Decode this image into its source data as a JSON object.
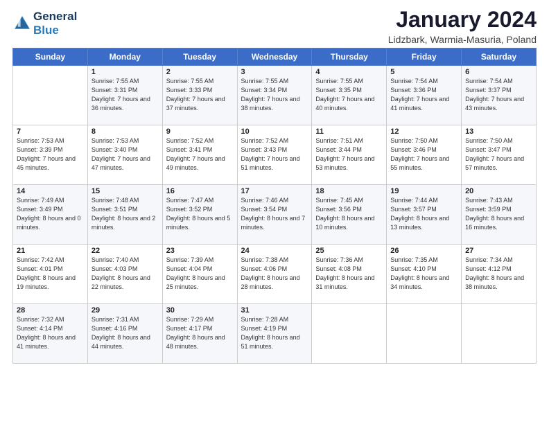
{
  "header": {
    "logo_line1": "General",
    "logo_line2": "Blue",
    "month_title": "January 2024",
    "location": "Lidzbark, Warmia-Masuria, Poland"
  },
  "weekdays": [
    "Sunday",
    "Monday",
    "Tuesday",
    "Wednesday",
    "Thursday",
    "Friday",
    "Saturday"
  ],
  "weeks": [
    [
      {
        "day": "",
        "sunrise": "",
        "sunset": "",
        "daylight": ""
      },
      {
        "day": "1",
        "sunrise": "Sunrise: 7:55 AM",
        "sunset": "Sunset: 3:31 PM",
        "daylight": "Daylight: 7 hours and 36 minutes."
      },
      {
        "day": "2",
        "sunrise": "Sunrise: 7:55 AM",
        "sunset": "Sunset: 3:33 PM",
        "daylight": "Daylight: 7 hours and 37 minutes."
      },
      {
        "day": "3",
        "sunrise": "Sunrise: 7:55 AM",
        "sunset": "Sunset: 3:34 PM",
        "daylight": "Daylight: 7 hours and 38 minutes."
      },
      {
        "day": "4",
        "sunrise": "Sunrise: 7:55 AM",
        "sunset": "Sunset: 3:35 PM",
        "daylight": "Daylight: 7 hours and 40 minutes."
      },
      {
        "day": "5",
        "sunrise": "Sunrise: 7:54 AM",
        "sunset": "Sunset: 3:36 PM",
        "daylight": "Daylight: 7 hours and 41 minutes."
      },
      {
        "day": "6",
        "sunrise": "Sunrise: 7:54 AM",
        "sunset": "Sunset: 3:37 PM",
        "daylight": "Daylight: 7 hours and 43 minutes."
      }
    ],
    [
      {
        "day": "7",
        "sunrise": "Sunrise: 7:53 AM",
        "sunset": "Sunset: 3:39 PM",
        "daylight": "Daylight: 7 hours and 45 minutes."
      },
      {
        "day": "8",
        "sunrise": "Sunrise: 7:53 AM",
        "sunset": "Sunset: 3:40 PM",
        "daylight": "Daylight: 7 hours and 47 minutes."
      },
      {
        "day": "9",
        "sunrise": "Sunrise: 7:52 AM",
        "sunset": "Sunset: 3:41 PM",
        "daylight": "Daylight: 7 hours and 49 minutes."
      },
      {
        "day": "10",
        "sunrise": "Sunrise: 7:52 AM",
        "sunset": "Sunset: 3:43 PM",
        "daylight": "Daylight: 7 hours and 51 minutes."
      },
      {
        "day": "11",
        "sunrise": "Sunrise: 7:51 AM",
        "sunset": "Sunset: 3:44 PM",
        "daylight": "Daylight: 7 hours and 53 minutes."
      },
      {
        "day": "12",
        "sunrise": "Sunrise: 7:50 AM",
        "sunset": "Sunset: 3:46 PM",
        "daylight": "Daylight: 7 hours and 55 minutes."
      },
      {
        "day": "13",
        "sunrise": "Sunrise: 7:50 AM",
        "sunset": "Sunset: 3:47 PM",
        "daylight": "Daylight: 7 hours and 57 minutes."
      }
    ],
    [
      {
        "day": "14",
        "sunrise": "Sunrise: 7:49 AM",
        "sunset": "Sunset: 3:49 PM",
        "daylight": "Daylight: 8 hours and 0 minutes."
      },
      {
        "day": "15",
        "sunrise": "Sunrise: 7:48 AM",
        "sunset": "Sunset: 3:51 PM",
        "daylight": "Daylight: 8 hours and 2 minutes."
      },
      {
        "day": "16",
        "sunrise": "Sunrise: 7:47 AM",
        "sunset": "Sunset: 3:52 PM",
        "daylight": "Daylight: 8 hours and 5 minutes."
      },
      {
        "day": "17",
        "sunrise": "Sunrise: 7:46 AM",
        "sunset": "Sunset: 3:54 PM",
        "daylight": "Daylight: 8 hours and 7 minutes."
      },
      {
        "day": "18",
        "sunrise": "Sunrise: 7:45 AM",
        "sunset": "Sunset: 3:56 PM",
        "daylight": "Daylight: 8 hours and 10 minutes."
      },
      {
        "day": "19",
        "sunrise": "Sunrise: 7:44 AM",
        "sunset": "Sunset: 3:57 PM",
        "daylight": "Daylight: 8 hours and 13 minutes."
      },
      {
        "day": "20",
        "sunrise": "Sunrise: 7:43 AM",
        "sunset": "Sunset: 3:59 PM",
        "daylight": "Daylight: 8 hours and 16 minutes."
      }
    ],
    [
      {
        "day": "21",
        "sunrise": "Sunrise: 7:42 AM",
        "sunset": "Sunset: 4:01 PM",
        "daylight": "Daylight: 8 hours and 19 minutes."
      },
      {
        "day": "22",
        "sunrise": "Sunrise: 7:40 AM",
        "sunset": "Sunset: 4:03 PM",
        "daylight": "Daylight: 8 hours and 22 minutes."
      },
      {
        "day": "23",
        "sunrise": "Sunrise: 7:39 AM",
        "sunset": "Sunset: 4:04 PM",
        "daylight": "Daylight: 8 hours and 25 minutes."
      },
      {
        "day": "24",
        "sunrise": "Sunrise: 7:38 AM",
        "sunset": "Sunset: 4:06 PM",
        "daylight": "Daylight: 8 hours and 28 minutes."
      },
      {
        "day": "25",
        "sunrise": "Sunrise: 7:36 AM",
        "sunset": "Sunset: 4:08 PM",
        "daylight": "Daylight: 8 hours and 31 minutes."
      },
      {
        "day": "26",
        "sunrise": "Sunrise: 7:35 AM",
        "sunset": "Sunset: 4:10 PM",
        "daylight": "Daylight: 8 hours and 34 minutes."
      },
      {
        "day": "27",
        "sunrise": "Sunrise: 7:34 AM",
        "sunset": "Sunset: 4:12 PM",
        "daylight": "Daylight: 8 hours and 38 minutes."
      }
    ],
    [
      {
        "day": "28",
        "sunrise": "Sunrise: 7:32 AM",
        "sunset": "Sunset: 4:14 PM",
        "daylight": "Daylight: 8 hours and 41 minutes."
      },
      {
        "day": "29",
        "sunrise": "Sunrise: 7:31 AM",
        "sunset": "Sunset: 4:16 PM",
        "daylight": "Daylight: 8 hours and 44 minutes."
      },
      {
        "day": "30",
        "sunrise": "Sunrise: 7:29 AM",
        "sunset": "Sunset: 4:17 PM",
        "daylight": "Daylight: 8 hours and 48 minutes."
      },
      {
        "day": "31",
        "sunrise": "Sunrise: 7:28 AM",
        "sunset": "Sunset: 4:19 PM",
        "daylight": "Daylight: 8 hours and 51 minutes."
      },
      {
        "day": "",
        "sunrise": "",
        "sunset": "",
        "daylight": ""
      },
      {
        "day": "",
        "sunrise": "",
        "sunset": "",
        "daylight": ""
      },
      {
        "day": "",
        "sunrise": "",
        "sunset": "",
        "daylight": ""
      }
    ]
  ]
}
